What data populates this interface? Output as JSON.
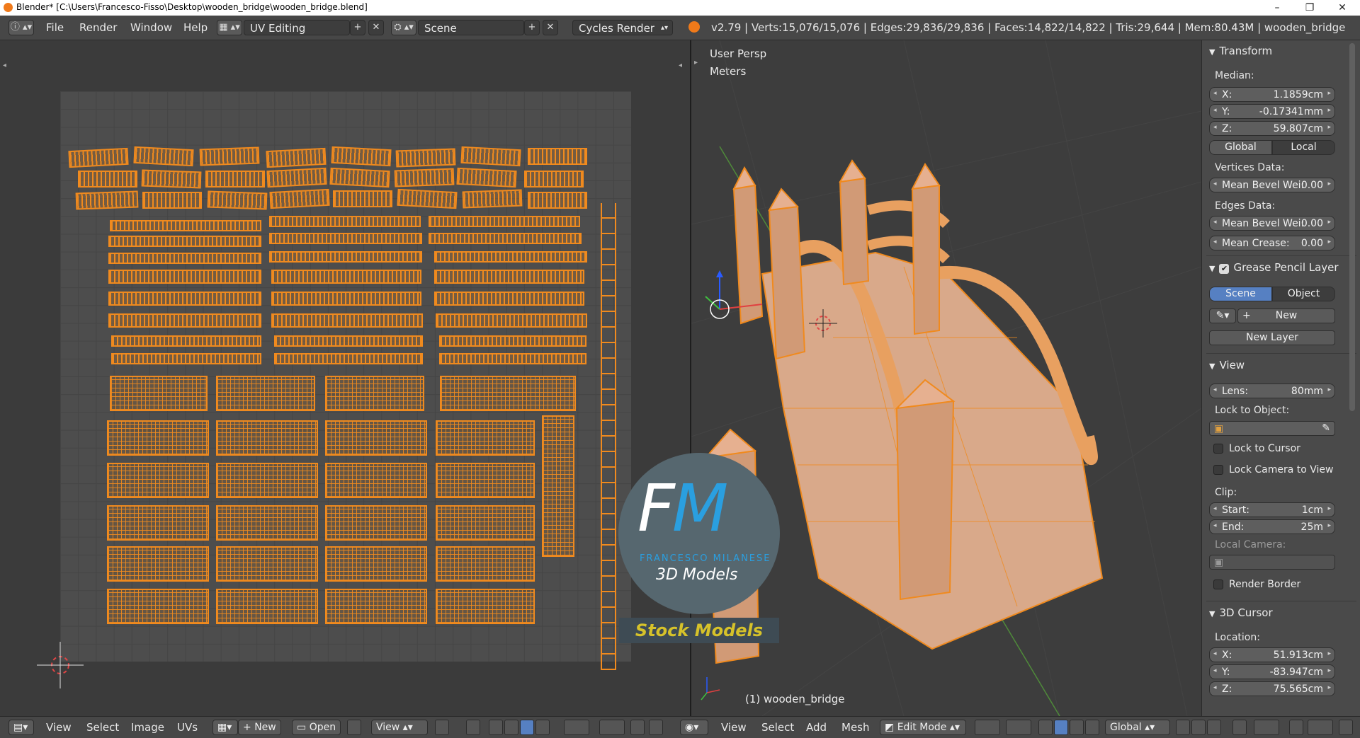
{
  "window": {
    "title": "Blender* [C:\\Users\\Francesco-Fisso\\Desktop\\wooden_bridge\\wooden_bridge.blend]",
    "controls": [
      "–",
      "❐",
      "✕"
    ]
  },
  "topbar": {
    "menus": [
      "File",
      "Render",
      "Window",
      "Help"
    ],
    "screen_layout": "UV Editing",
    "scene": "Scene",
    "render_engine": "Cycles Render",
    "status": "v2.79 | Verts:15,076/15,076 | Edges:29,836/29,836 | Faces:14,822/14,822 | Tris:29,644 | Mem:80.43M | wooden_bridge"
  },
  "viewport": {
    "view_name": "User Persp",
    "units": "Meters",
    "object_label": "(1) wooden_bridge"
  },
  "properties": {
    "transform": {
      "header": "Transform",
      "median_label": "Median:",
      "x_label": "X:",
      "x_value": "1.1859cm",
      "y_label": "Y:",
      "y_value": "-0.17341mm",
      "z_label": "Z:",
      "z_value": "59.807cm",
      "global": "Global",
      "local": "Local",
      "vertices_data": "Vertices Data:",
      "v_bevel_label": "Mean Bevel Wei:",
      "v_bevel_value": "0.00",
      "edges_data": "Edges Data:",
      "e_bevel_label": "Mean Bevel Wei:",
      "e_bevel_value": "0.00",
      "crease_label": "Mean Crease:",
      "crease_value": "0.00"
    },
    "grease_pencil": {
      "header": "Grease Pencil Layer",
      "scene": "Scene",
      "object": "Object",
      "new": "New",
      "new_layer": "New Layer"
    },
    "view": {
      "header": "View",
      "lens_label": "Lens:",
      "lens_value": "80mm",
      "lock_to_object": "Lock to Object:",
      "lock_to_cursor": "Lock to Cursor",
      "lock_camera": "Lock Camera to View",
      "clip": "Clip:",
      "start_label": "Start:",
      "start_value": "1cm",
      "end_label": "End:",
      "end_value": "25m",
      "local_camera": "Local Camera:",
      "render_border": "Render Border"
    },
    "cursor": {
      "header": "3D Cursor",
      "location": "Location:",
      "x_label": "X:",
      "x_value": "51.913cm",
      "y_label": "Y:",
      "y_value": "-83.947cm",
      "z_label": "Z:",
      "z_value": "75.565cm"
    }
  },
  "uv_bottom": {
    "menus": [
      "View",
      "Select",
      "Image",
      "UVs"
    ],
    "new": "New",
    "open": "Open",
    "view": "View"
  },
  "vp_bottom": {
    "menus": [
      "View",
      "Select",
      "Add",
      "Mesh"
    ],
    "mode": "Edit Mode",
    "orientation": "Global"
  },
  "watermark": {
    "initial_f": "F",
    "initial_m": "M",
    "name": "FRANCESCO MILANESE",
    "tagline": "3D Models",
    "banner": "Stock Models"
  },
  "colors": {
    "selection_orange": "#f08a1e",
    "active_blue": "#5680c2",
    "background": "#393939"
  }
}
